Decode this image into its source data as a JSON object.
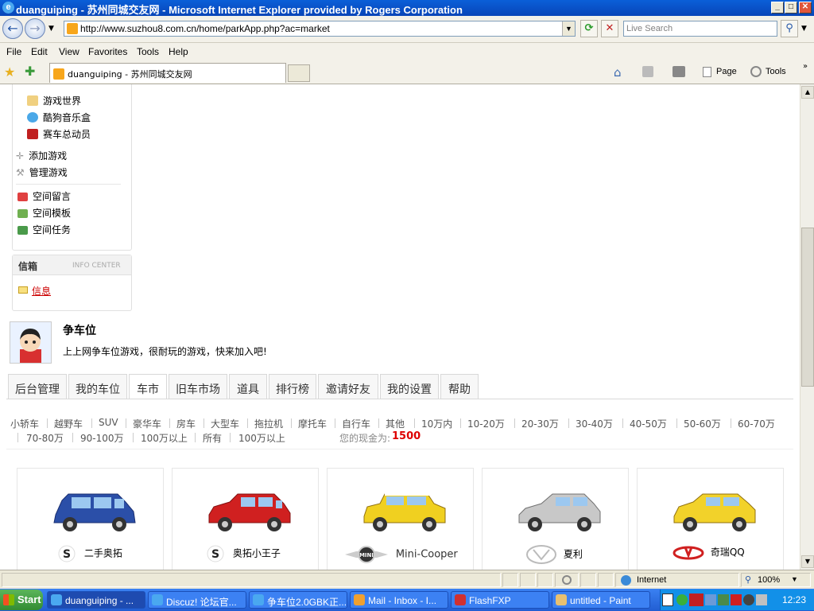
{
  "window": {
    "title": "duanguiping - 苏州同城交友网 - Microsoft Internet Explorer provided by Rogers Corporation",
    "ie_icon": "e"
  },
  "address": {
    "url": "http://www.suzhou8.com.cn/home/parkApp.php?ac=market",
    "search_placeholder": "Live Search"
  },
  "menu": [
    "File",
    "Edit",
    "View",
    "Favorites",
    "Tools",
    "Help"
  ],
  "tab": {
    "title": "duanguiping - 苏州同城交友网"
  },
  "commands": {
    "page": "Page",
    "tools": "Tools"
  },
  "sidebar": {
    "games": [
      "游戏世界",
      "酷狗音乐盒",
      "赛车总动员"
    ],
    "manage": [
      "添加游戏",
      "管理游戏"
    ],
    "space": [
      "空间留言",
      "空间模板",
      "空间任务"
    ],
    "mailbox_title": "信箱",
    "mailbox_sub": "INFO CENTER",
    "mailbox_link": "信息"
  },
  "app": {
    "name": "争车位",
    "desc": "上上网争车位游戏，很耐玩的游戏，快来加入吧!"
  },
  "tabs": [
    "后台管理",
    "我的车位",
    "车市",
    "旧车市场",
    "道具",
    "排行榜",
    "邀请好友",
    "我的设置",
    "帮助"
  ],
  "filters_row1": [
    "小轿车",
    "越野车",
    "SUV",
    "豪华车",
    "房车",
    "大型车",
    "拖拉机",
    "摩托车",
    "自行车",
    "其他",
    "10万内",
    "10-20万",
    "20-30万",
    "30-40万",
    "40-50万",
    "50-60万",
    "60-70万"
  ],
  "filters_row2": [
    "70-80万",
    "90-100万",
    "100万以上",
    "所有",
    "100万以上"
  ],
  "cash": {
    "label": "您的现金为:",
    "value": "1500"
  },
  "cars": [
    {
      "brand": "二手奥拓",
      "color": "#2b4fa8"
    },
    {
      "brand": "奥拓小王子",
      "color": "#d02020"
    },
    {
      "brand": "Mini-Cooper",
      "color": "#f0d020"
    },
    {
      "brand": "夏利",
      "color": "#c8c8c8"
    },
    {
      "brand": "奇瑞QQ",
      "color": "#f2d22a"
    }
  ],
  "status": {
    "zone": "Internet",
    "zoom": "100%"
  },
  "taskbar": {
    "start": "Start",
    "tasks": [
      "duanguiping - ...",
      "Discuz! 论坛官...",
      "争车位2.0GBK正...",
      "Mail - Inbox - I...",
      "FlashFXP",
      "untitled - Paint"
    ],
    "clock": "12:23"
  }
}
